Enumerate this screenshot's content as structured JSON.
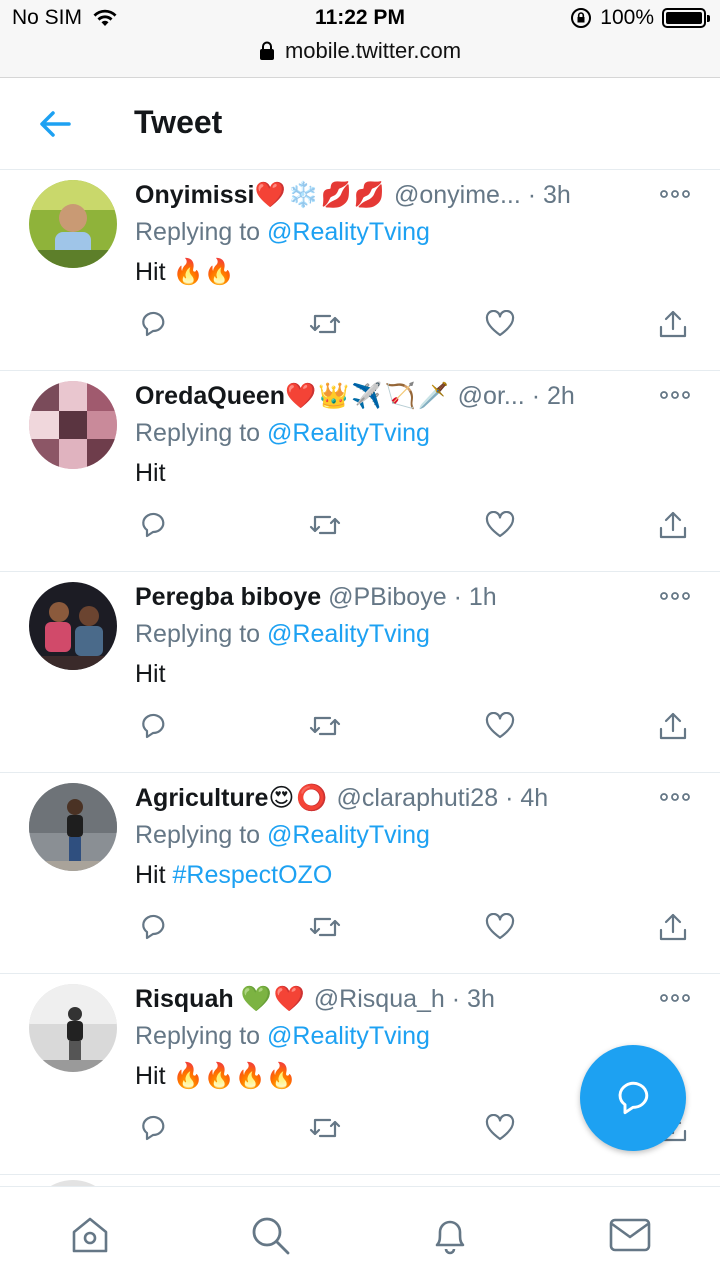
{
  "status_bar": {
    "carrier": "No SIM",
    "time": "11:22 PM",
    "battery": "100%",
    "url": "mobile.twitter.com"
  },
  "header": {
    "title": "Tweet"
  },
  "tweets": [
    {
      "name": "Onyimissi",
      "emojis": "❤️❄️💋💋",
      "handle": "@onyime...",
      "time": "· 3h",
      "replying_prefix": "Replying to ",
      "mention": "@RealityTving",
      "text": "Hit 🔥🔥",
      "hashtag": ""
    },
    {
      "name": "OredaQueen",
      "emojis": "❤️👑✈️🏹🗡️",
      "handle": "@or...",
      "time": "· 2h",
      "replying_prefix": "Replying to ",
      "mention": "@RealityTving",
      "text": "Hit",
      "hashtag": ""
    },
    {
      "name": "Peregba biboye",
      "emojis": "",
      "handle": "@PBiboye",
      "time": "· 1h",
      "replying_prefix": "Replying to ",
      "mention": "@RealityTving",
      "text": "Hit",
      "hashtag": ""
    },
    {
      "name": "Agriculture",
      "emojis": "😍⭕",
      "handle": "@claraphuti28",
      "time": "· 4h",
      "replying_prefix": "Replying to ",
      "mention": "@RealityTving",
      "text": "Hit ",
      "hashtag": "#RespectOZO"
    },
    {
      "name": "Risquah",
      "emojis": "💚❤️",
      "handle": "@Risqua_h",
      "time": "· 3h",
      "replying_prefix": "Replying to ",
      "mention": "@RealityTving",
      "text": "Hit 🔥🔥🔥🔥",
      "hashtag": ""
    }
  ],
  "colors": {
    "accent": "#1da1f2",
    "secondary_text": "#657786",
    "icon_gray": "#657786",
    "divider": "#e6ecf0"
  },
  "icons": {
    "back": "arrow-left-icon",
    "more": "more-icon",
    "reply": "reply-icon",
    "retweet": "retweet-icon",
    "like": "heart-icon",
    "share": "share-icon",
    "compose": "compose-reply-icon",
    "home": "home-icon",
    "search": "search-icon",
    "notifications": "bell-icon",
    "messages": "mail-icon"
  }
}
